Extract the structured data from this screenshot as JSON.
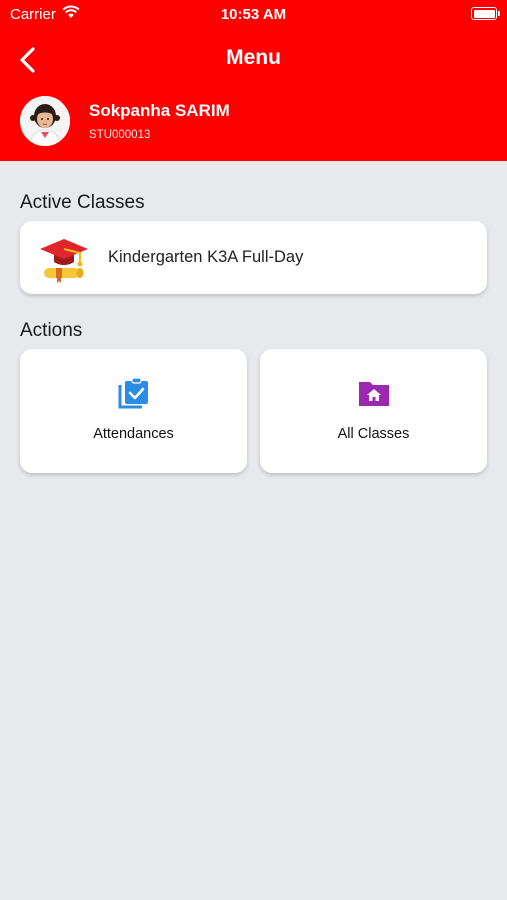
{
  "status_bar": {
    "carrier": "Carrier",
    "time": "10:53 AM"
  },
  "header": {
    "title": "Menu",
    "user": {
      "name": "Sokpanha SARIM",
      "id": "STU000013"
    }
  },
  "active_classes": {
    "title": "Active Classes",
    "items": [
      {
        "label": "Kindergarten K3A Full-Day",
        "icon": "graduation-cap-icon"
      }
    ]
  },
  "actions": {
    "title": "Actions",
    "items": [
      {
        "label": "Attendances",
        "icon": "clipboard-check-icon",
        "color": "#2b8ce6"
      },
      {
        "label": "All Classes",
        "icon": "folder-home-icon",
        "color": "#9c27b0"
      }
    ]
  },
  "colors": {
    "header": "#ff0000",
    "background": "#e8e9ed"
  }
}
